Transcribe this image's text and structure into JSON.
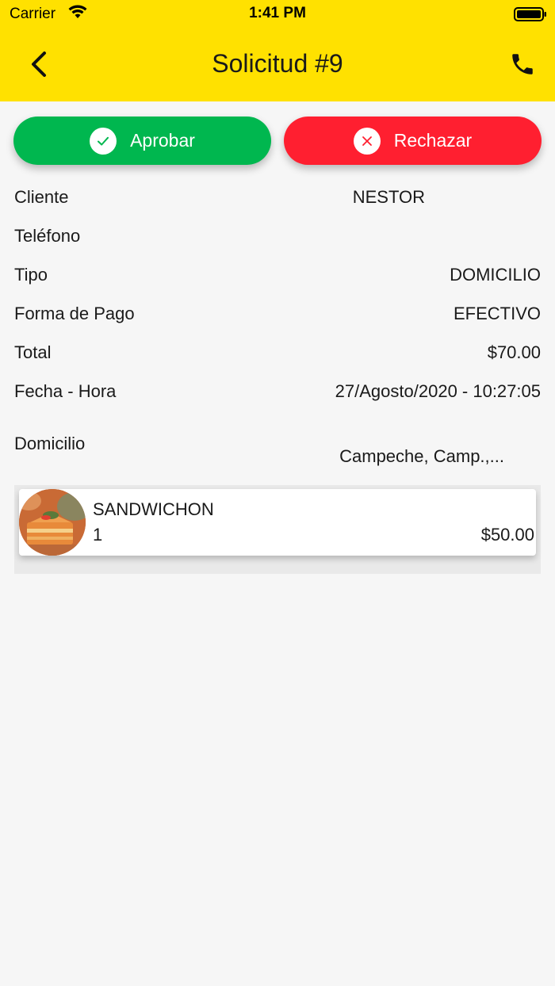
{
  "status_bar": {
    "carrier": "Carrier",
    "time": "1:41 PM"
  },
  "header": {
    "title": "Solicitud #9",
    "back_icon": "chevron-left-icon",
    "call_icon": "phone-icon",
    "background": "#ffe100"
  },
  "actions": {
    "approve_label": "Aprobar",
    "reject_label": "Rechazar",
    "approve_color": "#00b74f",
    "reject_color": "#ff1f30"
  },
  "details": {
    "cliente": {
      "label": "Cliente",
      "value": "NESTOR"
    },
    "telefono": {
      "label": "Teléfono",
      "value": ""
    },
    "tipo": {
      "label": "Tipo",
      "value": "DOMICILIO"
    },
    "forma_pago": {
      "label": "Forma de Pago",
      "value": "EFECTIVO"
    },
    "total": {
      "label": "Total",
      "value": "$70.00"
    },
    "fecha_hora": {
      "label": "Fecha - Hora",
      "value": "27/Agosto/2020 - 10:27:05"
    },
    "domicilio": {
      "label": "Domicilio",
      "value": "Campeche, Camp.,..."
    }
  },
  "items": [
    {
      "name": "SANDWICHON",
      "quantity": "1",
      "price": "$50.00"
    }
  ]
}
